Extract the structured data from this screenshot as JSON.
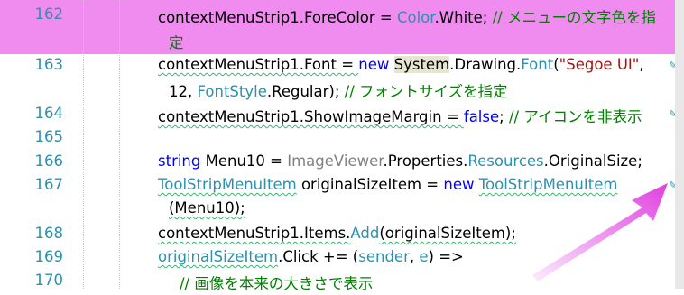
{
  "lines": [
    {
      "num": "162",
      "code": [
        "contextMenuStrip1.ForeColor = ",
        "Color",
        ".White; ",
        "// メニューの文字色を指"
      ],
      "cont": "定"
    },
    {
      "num": "163",
      "code": [
        "contextMenuStrip1.Font = ",
        "new",
        " ",
        "System",
        ".Drawing.",
        "Font",
        "(",
        "\"Segoe UI\"",
        ","
      ],
      "cont": [
        "12, ",
        "FontStyle",
        ".Regular); ",
        "// フォントサイズを指定"
      ]
    },
    {
      "num": "164",
      "code": [
        "contextMenuStrip1.ShowImageMargin = ",
        "false",
        "; ",
        "// アイコンを非表示"
      ]
    },
    {
      "num": "165",
      "code": []
    },
    {
      "num": "166",
      "code": [
        "string",
        " Menu10 = ",
        "ImageViewer",
        ".Properties.",
        "Resources",
        ".OriginalSize;"
      ]
    },
    {
      "num": "167",
      "code": [
        "ToolStripMenuItem",
        " originalSizeItem = ",
        "new",
        " ",
        "ToolStripMenuItem"
      ],
      "cont": "(Menu10);"
    },
    {
      "num": "168",
      "code": [
        "contextMenuStrip1.Items.",
        "Add",
        "(originalSizeItem);"
      ]
    },
    {
      "num": "169",
      "code": [
        "originalSizeItem",
        ".Click += (",
        "sender",
        ", ",
        "e",
        ") =>"
      ]
    },
    {
      "num": "170",
      "code": [
        "// 画像を本来の大きさで表示"
      ]
    }
  ],
  "colors": {
    "highlight": "#f08cf0",
    "keyword": "#0000ff",
    "type": "#2b91af",
    "string": "#a31515",
    "comment": "#008000",
    "line_number": "#2b91af",
    "arrow": "#e040e0"
  },
  "icons": {
    "edit_marker": "pencil-icon",
    "pointer": "magenta-arrow"
  }
}
